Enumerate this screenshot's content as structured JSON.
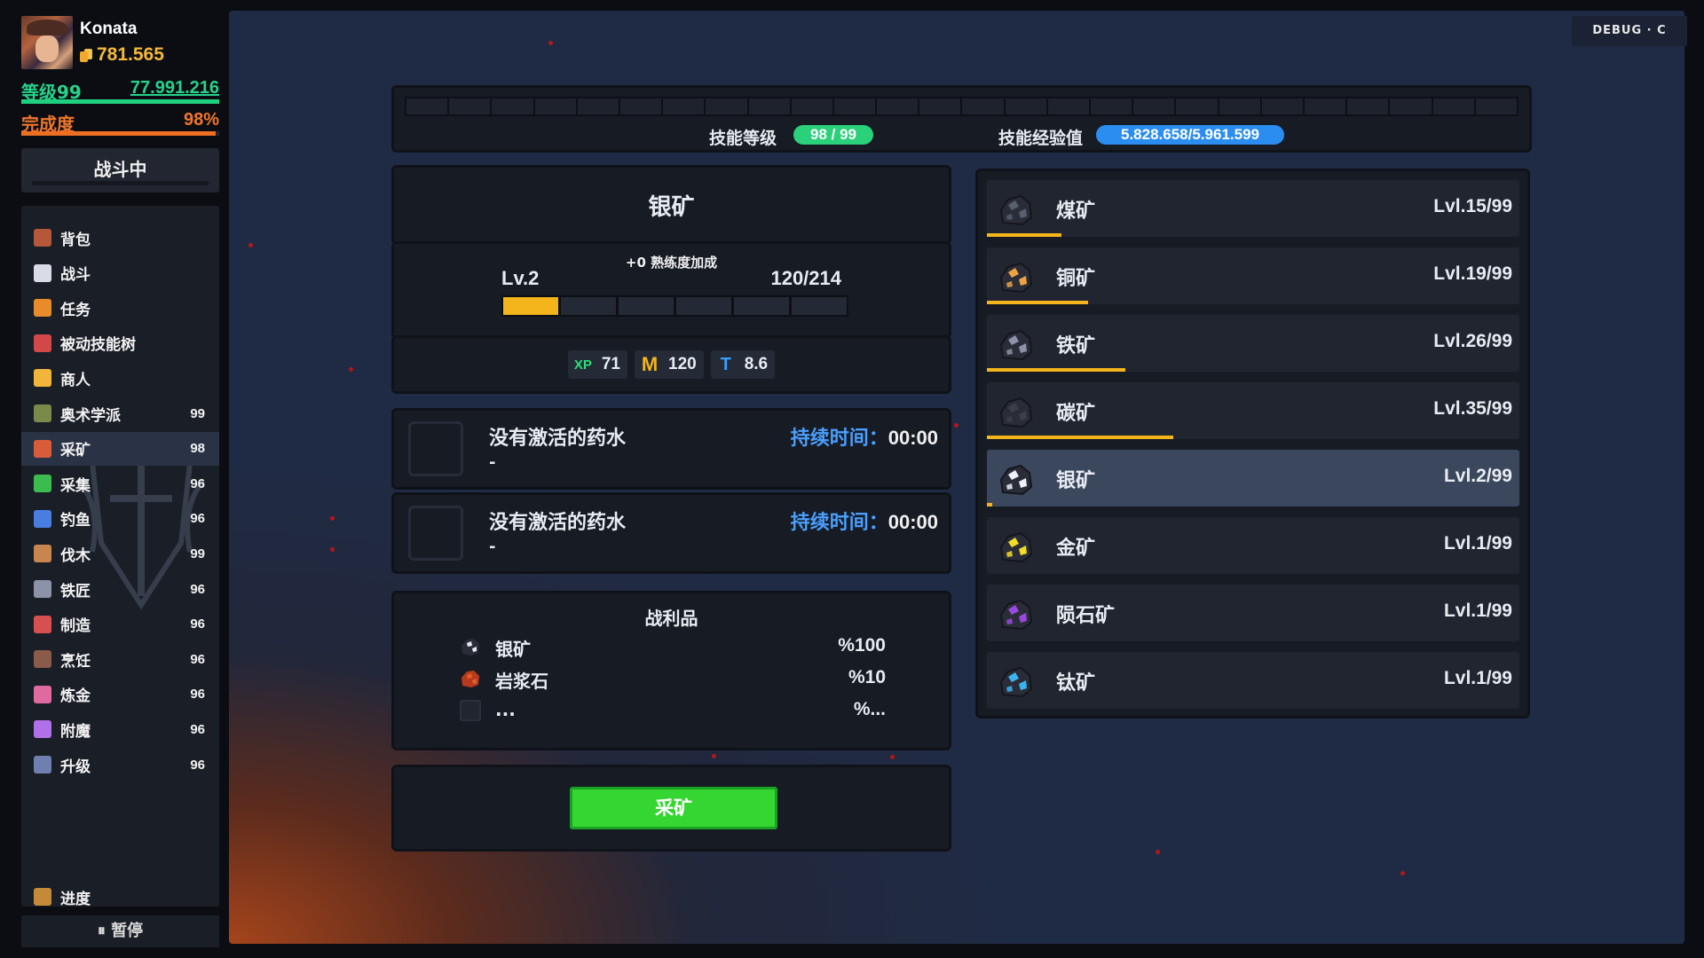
{
  "player": {
    "name": "Konata",
    "gold": "781.565",
    "level_label": "等级99",
    "level_xp": "77.991.216",
    "level_progress": 1.0,
    "completion_label": "完成度",
    "completion_value": "98%",
    "completion_progress": 0.98
  },
  "status": {
    "combat": "战斗中"
  },
  "nav": [
    {
      "label": "背包",
      "count": "",
      "icon": "backpack-icon",
      "color": "#b5583a"
    },
    {
      "label": "战斗",
      "count": "",
      "icon": "sword-icon",
      "color": "#d9dce6"
    },
    {
      "label": "任务",
      "count": "",
      "icon": "quest-icon",
      "color": "#e88b2a"
    },
    {
      "label": "被动技能树",
      "count": "",
      "icon": "skull-icon",
      "color": "#d24848"
    },
    {
      "label": "商人",
      "count": "",
      "icon": "merchant-icon",
      "color": "#f2b53b"
    },
    {
      "label": "奥术学派",
      "count": "99",
      "icon": "arcane-icon",
      "color": "#7a8a4a"
    },
    {
      "label": "采矿",
      "count": "98",
      "icon": "mining-icon",
      "color": "#d85c3a"
    },
    {
      "label": "采集",
      "count": "96",
      "icon": "leaf-icon",
      "color": "#3cbb4e"
    },
    {
      "label": "钓鱼",
      "count": "96",
      "icon": "fishing-icon",
      "color": "#4a7de0"
    },
    {
      "label": "伐木",
      "count": "99",
      "icon": "axe-icon",
      "color": "#c98550"
    },
    {
      "label": "铁匠",
      "count": "96",
      "icon": "anvil-icon",
      "color": "#8c93a8"
    },
    {
      "label": "制造",
      "count": "96",
      "icon": "crafting-icon",
      "color": "#d65050"
    },
    {
      "label": "烹饪",
      "count": "96",
      "icon": "cooking-icon",
      "color": "#8a5a4a"
    },
    {
      "label": "炼金",
      "count": "96",
      "icon": "alchemy-icon",
      "color": "#e06aa0"
    },
    {
      "label": "附魔",
      "count": "96",
      "icon": "enchant-icon",
      "color": "#b070e8"
    },
    {
      "label": "升级",
      "count": "96",
      "icon": "upgrade-icon",
      "color": "#6e7fb0"
    }
  ],
  "nav_active_index": 6,
  "progress_nav": {
    "label": "进度",
    "icon": "progress-icon"
  },
  "pause": {
    "label": "⏸ 暂停"
  },
  "debug": {
    "label": "DEBUG · C"
  },
  "skill": {
    "level_label": "技能等级",
    "level_value": "98 / 99",
    "xp_label": "技能经验值",
    "xp_value": "5.828.658/5.961.599",
    "segments": 26
  },
  "selected_ore": {
    "name": "银矿",
    "bonus": "+0 熟练度加成",
    "level": "Lv.2",
    "progress_text": "120/214",
    "segments": 6,
    "filled_segments": 1,
    "stats": [
      {
        "badge": "XP",
        "value": "71",
        "kind": "xp"
      },
      {
        "badge": "M",
        "value": "120",
        "kind": "m"
      },
      {
        "badge": "T",
        "value": "8.6",
        "kind": "t"
      }
    ]
  },
  "potions": [
    {
      "title": "没有激活的药水",
      "desc": "-",
      "duration_label": "持续时间：",
      "duration_value": "00:00"
    },
    {
      "title": "没有激活的药水",
      "desc": "-",
      "duration_label": "持续时间：",
      "duration_value": "00:00"
    }
  ],
  "loot": {
    "title": "战利品",
    "items": [
      {
        "name": "银矿",
        "chance": "%100",
        "icon": "silver-ore-icon",
        "color": "#e8ecf5"
      },
      {
        "name": "岩浆石",
        "chance": "%10",
        "icon": "magma-stone-icon",
        "color": "#e0632a"
      },
      {
        "name": "...",
        "chance": "%...",
        "icon": "unknown-item-icon",
        "color": "#20252f"
      }
    ]
  },
  "mine_button": "采矿",
  "ores": [
    {
      "name": "煤矿",
      "level": "Lvl.15/99",
      "progress": 0.14,
      "color": "#56606e"
    },
    {
      "name": "铜矿",
      "level": "Lvl.19/99",
      "progress": 0.19,
      "color": "#f0a240"
    },
    {
      "name": "铁矿",
      "level": "Lvl.26/99",
      "progress": 0.26,
      "color": "#8c93a8"
    },
    {
      "name": "碳矿",
      "level": "Lvl.35/99",
      "progress": 0.35,
      "color": "#3a3f4a"
    },
    {
      "name": "银矿",
      "level": "Lvl.2/99",
      "progress": 0.01,
      "color": "#eef1f7"
    },
    {
      "name": "金矿",
      "level": "Lvl.1/99",
      "progress": 0.0,
      "color": "#f2dc25"
    },
    {
      "name": "陨石矿",
      "level": "Lvl.1/99",
      "progress": 0.0,
      "color": "#9a48e0"
    },
    {
      "name": "钛矿",
      "level": "Lvl.1/99",
      "progress": 0.0,
      "color": "#3ab5f0"
    }
  ],
  "ores_active_index": 4
}
